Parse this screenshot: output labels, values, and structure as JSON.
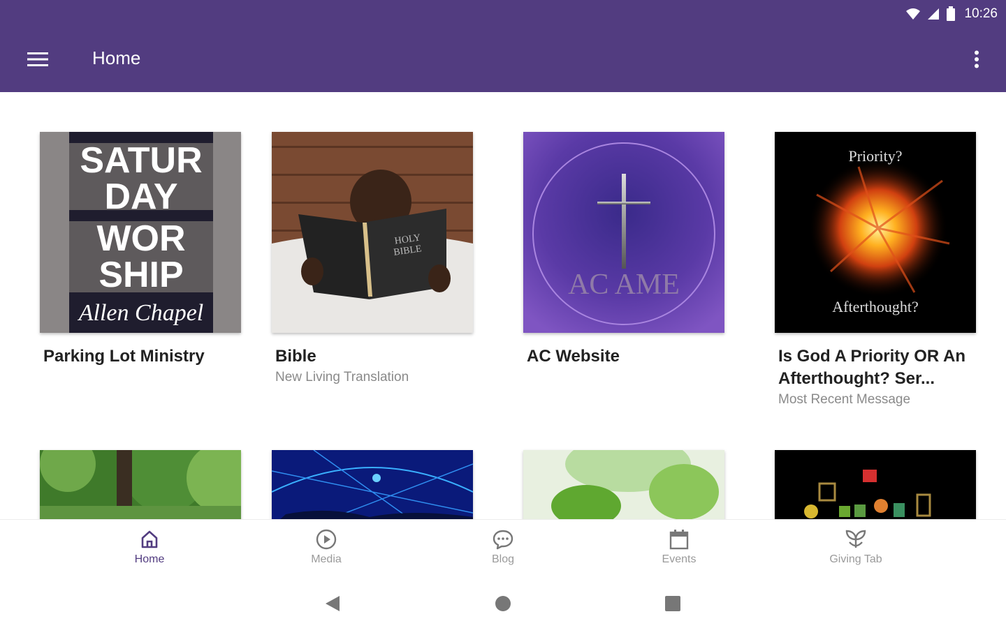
{
  "status_bar": {
    "time": "10:26"
  },
  "app_bar": {
    "title": "Home"
  },
  "cards": [
    {
      "title": "Parking Lot Ministry",
      "subtitle": "",
      "image_text": [
        "SATUR",
        "DAY",
        "WOR",
        "SHIP",
        "Allen Chapel"
      ]
    },
    {
      "title": "Bible",
      "subtitle": "New Living Translation",
      "image_text": [
        "HOLY",
        "BIBLE"
      ]
    },
    {
      "title": "AC Website",
      "subtitle": "",
      "image_text": [
        "AC AME"
      ]
    },
    {
      "title": "Is God A Priority OR An Afterthought? Ser...",
      "subtitle": "Most Recent Message",
      "image_text": [
        "Priority?",
        "Afterthought?"
      ]
    }
  ],
  "bottom_nav": [
    {
      "label": "Home",
      "icon": "home-icon",
      "active": true
    },
    {
      "label": "Media",
      "icon": "play-circle-icon",
      "active": false
    },
    {
      "label": "Blog",
      "icon": "chat-bubble-icon",
      "active": false
    },
    {
      "label": "Events",
      "icon": "calendar-icon",
      "active": false
    },
    {
      "label": "Giving Tab",
      "icon": "plant-icon",
      "active": false
    }
  ],
  "colors": {
    "primary": "#523c80",
    "inactive": "#9a9a9a"
  }
}
